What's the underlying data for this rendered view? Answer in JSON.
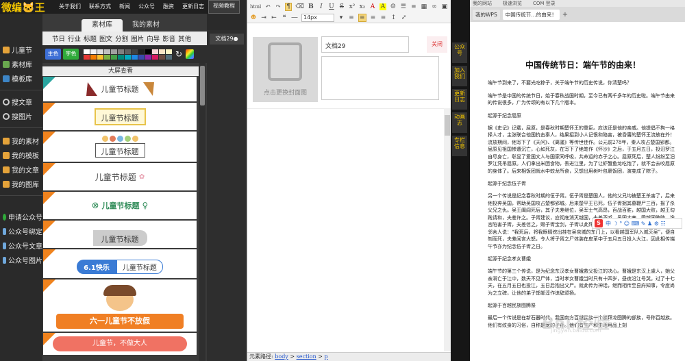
{
  "topnav": {
    "logo": "微编🐱王",
    "items": [
      "关于我们",
      "联系方式",
      "新闻",
      "公众号",
      "融资",
      "更新日志",
      "视频教程"
    ]
  },
  "sidebar": {
    "groups": [
      [
        {
          "label": "儿童节",
          "icon": "child-icon"
        },
        {
          "label": "素材库",
          "icon": "library-icon"
        },
        {
          "label": "模板库",
          "icon": "template-icon"
        }
      ],
      [
        {
          "label": "搜文章",
          "icon": "search-icon"
        },
        {
          "label": "搜图片",
          "icon": "image-search-icon"
        }
      ],
      [
        {
          "label": "我的素材",
          "icon": "folder-icon"
        },
        {
          "label": "我的模板",
          "icon": "folder-icon"
        },
        {
          "label": "我的文章",
          "icon": "folder-icon"
        },
        {
          "label": "我的图库",
          "icon": "folder-icon"
        }
      ],
      [
        {
          "label": "申请公众号",
          "icon": "wechat-icon"
        },
        {
          "label": "公众号绑定",
          "icon": "link-icon"
        },
        {
          "label": "公众号文章",
          "icon": "article-icon"
        },
        {
          "label": "公众号图片",
          "icon": "picture-icon"
        }
      ]
    ]
  },
  "panel": {
    "tabs": [
      "素材库",
      "我的素材"
    ],
    "categories": [
      "节日",
      "行业",
      "标题",
      "图文",
      "分割",
      "图片",
      "向导",
      "影音",
      "其他"
    ],
    "color_btn": "主色",
    "text_btn": "字色",
    "swatches": [
      "#ffffff",
      "#f2f2f2",
      "#e0e0e0",
      "#c0c0c0",
      "#a0a0a0",
      "#808080",
      "#606060",
      "#404040",
      "#202020",
      "#000000",
      "#f8d7d7",
      "#fbe5c6",
      "#fff6c6",
      "#e53935",
      "#f57c00",
      "#fbc02d",
      "#7cb342",
      "#43a047",
      "#00897b",
      "#00acc1",
      "#1e88e5",
      "#3949ab",
      "#8e24aa",
      "#d81b60",
      "#6d4c41",
      "#546e7a"
    ],
    "big_view": "大屏查看",
    "cards": [
      {
        "text": "儿童节标题"
      },
      {
        "text": "儿童节标题"
      },
      {
        "text": "儿童节标题"
      },
      {
        "text": "儿童节标题"
      },
      {
        "text": "儿童节标题"
      },
      {
        "text": "儿童节标题"
      },
      {
        "text": "6.1快乐",
        "text2": "儿童节标题"
      },
      {
        "text": "六一儿童节不放假"
      },
      {
        "text": "儿童节，不做大人"
      }
    ]
  },
  "doc_tab": "文档29●",
  "editor": {
    "toolbar_row1": [
      "B",
      "I",
      "U",
      "S",
      "x²",
      "x₂",
      "A",
      "A"
    ],
    "font_size": "14px",
    "cover_text": "点击更换封面图",
    "title_value": "文档29",
    "close": "关闭",
    "status_label": "元素路径:",
    "path": [
      "body",
      "section",
      "p"
    ]
  },
  "darkstrip": [
    "公众号",
    "加入我们",
    "更新日志",
    "动画志",
    "专栏信息"
  ],
  "browser": {
    "top_links": [
      "我的网站",
      "极速浏览",
      "COM 登录"
    ],
    "tabs": [
      "我的WPS",
      "中国传统节…的由来！"
    ],
    "article": {
      "title": "中国传统节日：端午节的由来！",
      "p1": "端午节到来了，不要光吃粽子，关于端午节的历史传说，你清楚吗？",
      "p2": "端午节是中国的传统节日，始于春秋战国时期，至今已有两千多年的历史啦。端午节由来的传说很多，广为传颂的有以下几个版本。",
      "h1": "起源于纪念屈原",
      "p3": "据《史记》记载，屈原，是春秋时期楚怀王的重臣。应该还是他的亲戚。他提倡不拘一格择人才，主张联合他国抗击秦人，结果招到小人记恨和陷害，被昏庸的楚怀王流放在外！流放期间，他写下了《天问》、《离骚》等传世佳作。公元前278年，秦人攻占楚国郢都。屈原见祖国惨遭沉亡，心如死灰，在写下了绝笔作《怀沙》之后，于五月五日，投汨罗江自尽身亡，彰显了爱国文人与国家同呼吸，共命运的赤子之心。屈原死后，楚人纷纷至汨罗江凭吊屈原。人们拿出米团食物，丢进江里，为了让虾蟹鱼龙吃饱了，就不会去咬屈原的身体了。后来相饭团就水中蛟龙所食，又想出用树叶包裹饭团，演变成了粽子。",
      "h2": "起源于纪念伍子胥",
      "p4": "另一个传说是纪念春秋时期的伍子胥。伍子胥是楚国人，他的父兄均被楚王杀害了，后来他投奔吴国，帮助吴国攻占楚都郢城。后来楚平王已死，伍子胥掘其墓鞭尸三百，报了杀父兄之仇。吴王阖闾死后，其子夫差继位，吴军士气高昂，百战百胜，越国大败，越王勾践请和，夫差许之。子胥建议，应彻底消灭越国，夫差不听，吴国大宰，受越国贿赂，谗言陷害子胥，夫差信之，赐子胥宝剑，子胥以此死。子胥本为忠良，视死如归，在死前对邻舍人说：“我死后，将我眼睛挖出挂在吴京城的东门上，以看越国军队入城灭吴”，便自刎而死，夫差闻言大怒，令人将子胥之尸体装在皮革中于五月五日投入大江，因此相传端午节亦为纪念伍子胥之日。",
      "h3": "起源于纪念孝女曹娥",
      "p5": "端午节的第三个传说，是为纪念东汉孝女曹娥救父投江的决心。曹娥是东汉上虞人，她父亲溺亡于江中，数天不见尸体，当时孝女曹娥当时只有十四岁，昼夜沿江号哭。过了十七天，在五月五日也投江，五日后抱出父尸。就此传为神话，继而相传至县府知事，令度尚为之立碑，让他的弟子邯郸淳作诔辞颂扬。",
      "h4": "起源于百越民族图腾祭",
      "p6": "最后一个传说是在新石器时代，我国南方百越民族一个崇拜龙图腾的部族，号称百越族。他们有纹身的习俗，自称是龙的子孙。他们有生产和生活用品上刻"
    },
    "sogou": "中 ☽ ° ☺ ⌨ ✎ ♟ ⚙ ☷",
    "watermark": "Bai 经验",
    "watermark_sub": "jingyan.baidu.com"
  }
}
